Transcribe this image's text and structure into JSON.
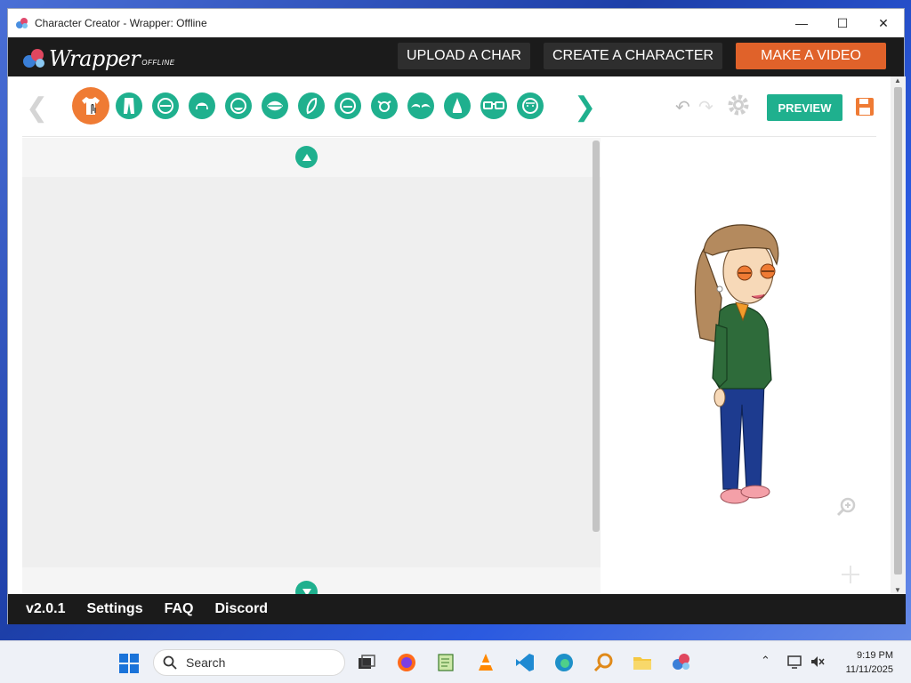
{
  "window": {
    "title": "Character Creator - Wrapper: Offline",
    "controls": {
      "minimize": "—",
      "maximize": "☐",
      "close": "✕"
    }
  },
  "header": {
    "logo_text": "Wrapper",
    "logo_sub": "OFFLINE",
    "nav": {
      "upload": "UPLOAD A CHAR",
      "create": "CREATE A CHARACTER",
      "make_video": "MAKE A VIDEO"
    },
    "accent": "#e0622a"
  },
  "toolbar": {
    "categories": [
      "shirt-icon",
      "pants-icon",
      "face-shape-icon",
      "hair-icon",
      "head-icon",
      "mouth-icon",
      "eyebrow-icon",
      "face-detail-icon",
      "eyes-icon",
      "eyebrows-icon",
      "nose-icon",
      "glasses-icon",
      "beard-icon"
    ],
    "active_category": "shirt-icon",
    "preview_label": "PREVIEW",
    "accent": "#1fb08e"
  },
  "footer": {
    "version": "v2.0.1",
    "settings": "Settings",
    "faq": "FAQ",
    "discord": "Discord"
  },
  "taskbar": {
    "search_label": "Search",
    "time": "9:19 PM",
    "date": "11/11/2025"
  }
}
